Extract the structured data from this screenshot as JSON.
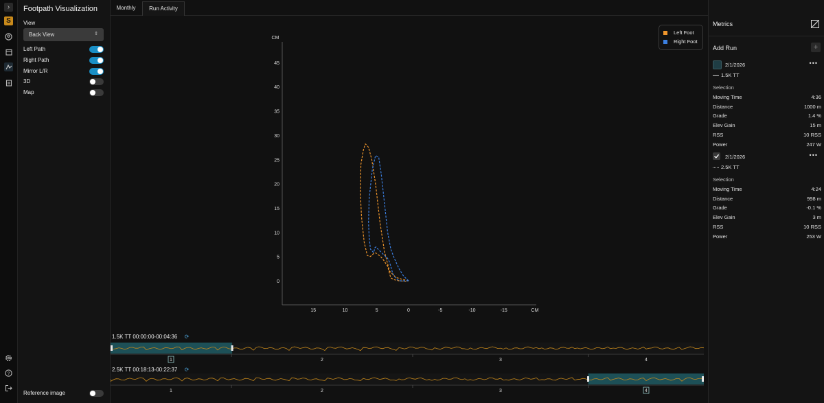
{
  "rail": {
    "icons": [
      "chevron-right-icon",
      "logo-icon",
      "user-icon",
      "calendar-icon",
      "footpath-icon",
      "notes-icon",
      "settings-icon",
      "help-icon",
      "logout-icon"
    ],
    "logo_letter": "S"
  },
  "left_panel": {
    "title": "Footpath Visualization",
    "view_label": "View",
    "view_value": "Back View",
    "toggles": [
      {
        "label": "Left Path",
        "on": true
      },
      {
        "label": "Right Path",
        "on": true
      },
      {
        "label": "Mirror L/R",
        "on": true
      },
      {
        "label": "3D",
        "on": false
      },
      {
        "label": "Map",
        "on": false
      }
    ],
    "reference_image": {
      "label": "Reference image",
      "on": false
    }
  },
  "tabs": [
    {
      "label": "Monthly",
      "active": false
    },
    {
      "label": "Run Activity",
      "active": true
    }
  ],
  "colors": {
    "left_foot": "#f0962c",
    "right_foot": "#3b7fe0",
    "accent": "#1a8fc6",
    "selection": "#1f5a63"
  },
  "chart_data": {
    "type": "line",
    "title": "",
    "xlabel": "CM",
    "ylabel": "CM",
    "xlim": [
      20,
      -20
    ],
    "ylim": [
      -5,
      50
    ],
    "x_ticks": [
      15,
      10,
      5,
      0,
      -5,
      -10,
      -15
    ],
    "y_ticks": [
      0,
      5,
      10,
      15,
      20,
      25,
      30,
      35,
      40,
      45
    ],
    "legend": "top-right",
    "grid": false,
    "series": [
      {
        "name": "Left Foot",
        "style": "dashed",
        "x": [
          0,
          1,
          2,
          3,
          3.8,
          4.5,
          5.2,
          5.8,
          6.3,
          6.8,
          7.1,
          7.5,
          7.6,
          7.4,
          7,
          6.5,
          6,
          5.6,
          5.3,
          5,
          4.4,
          3.9,
          3.3,
          3,
          2.8,
          2.2,
          1.5,
          0.5,
          0
        ],
        "y": [
          0,
          0.3,
          0.7,
          2,
          6,
          12,
          20,
          25,
          27.5,
          28.2,
          27,
          24,
          18,
          13,
          8,
          5.2,
          5,
          5.5,
          5.8,
          5.6,
          5,
          4.2,
          3,
          1.5,
          0.6,
          0.2,
          0,
          -0.1,
          0
        ]
      },
      {
        "name": "Right Foot",
        "style": "dashed",
        "x": [
          0,
          0.8,
          1.5,
          2.2,
          2.8,
          3.3,
          3.8,
          4.3,
          4.7,
          5.2,
          5.7,
          6.2,
          6.3,
          6.2,
          6,
          5.5,
          5.3,
          5.1,
          4.8,
          4.4,
          3.8,
          3.4,
          3.1,
          2.8,
          2.5,
          2,
          1.5,
          0.7,
          0
        ],
        "y": [
          0,
          1,
          2.5,
          4.5,
          6.5,
          10,
          16,
          22,
          25.5,
          25.8,
          23,
          17,
          12,
          9,
          6.5,
          5.8,
          6.8,
          7,
          6.5,
          6,
          5.2,
          4.8,
          4.2,
          3,
          1.5,
          0.5,
          0,
          0,
          0
        ]
      }
    ]
  },
  "metrics": {
    "title": "Metrics",
    "add_run_label": "Add Run",
    "runs": [
      {
        "date": "2/1/2026",
        "checked": false,
        "line_style": "solid",
        "name": "1.5K TT",
        "selection_label": "Selection",
        "rows": [
          {
            "key": "Moving Time",
            "value": "4:36"
          },
          {
            "key": "Distance",
            "value": "1000 m"
          },
          {
            "key": "Grade",
            "value": "1.4 %"
          },
          {
            "key": "Elev Gain",
            "value": "15 m"
          },
          {
            "key": "RSS",
            "value": "10 RSS"
          },
          {
            "key": "Power",
            "value": "247 W"
          }
        ]
      },
      {
        "date": "2/1/2026",
        "checked": true,
        "line_style": "dotted",
        "name": "2.5K TT",
        "selection_label": "Selection",
        "rows": [
          {
            "key": "Moving Time",
            "value": "4:24"
          },
          {
            "key": "Distance",
            "value": "998 m"
          },
          {
            "key": "Grade",
            "value": "-0.1 %"
          },
          {
            "key": "Elev Gain",
            "value": "3 m"
          },
          {
            "key": "RSS",
            "value": "10 RSS"
          },
          {
            "key": "Power",
            "value": "253 W"
          }
        ]
      }
    ]
  },
  "timelines": [
    {
      "label": "1.5K TT 00:00:00-00:04:36",
      "laps": [
        "1",
        "2",
        "3",
        "4"
      ],
      "active_lap": "1",
      "selection": [
        0,
        0.205
      ]
    },
    {
      "label": "2.5K TT 00:18:13-00:22:37",
      "laps": [
        "1",
        "2",
        "3",
        "4"
      ],
      "active_lap": "4",
      "selection": [
        0.805,
        1
      ]
    }
  ]
}
